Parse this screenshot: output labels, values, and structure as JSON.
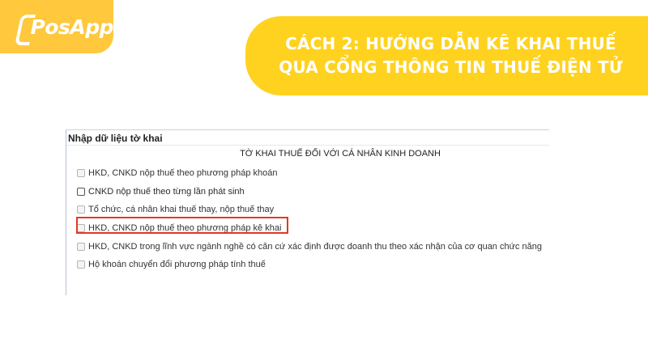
{
  "brand": {
    "logo_text": "PosApp",
    "color": "#FFC83D"
  },
  "banner": {
    "line1": "CÁCH 2: HƯỚNG DẪN KÊ KHAI THUẾ",
    "line2": "QUA CỔNG THÔNG TIN THUẾ ĐIỆN TỬ",
    "color": "#FFD21F"
  },
  "form": {
    "section_title": "Nhập dữ liệu tờ khai",
    "heading": "TỜ KHAI THUẾ ĐỐI VỚI CÁ NHÂN KINH DOANH",
    "options": [
      {
        "label": "HKD, CNKD nộp thuế theo phương pháp khoán",
        "checked": false,
        "enabled": false
      },
      {
        "label": "CNKD nộp thuế theo từng lần phát sinh",
        "checked": false,
        "enabled": true
      },
      {
        "label": "Tổ chức, cá nhân khai thuế thay, nộp thuế thay",
        "checked": false,
        "enabled": false
      },
      {
        "label": "HKD, CNKD nộp thuế theo phương pháp kê khai",
        "checked": false,
        "enabled": false,
        "highlighted": true
      },
      {
        "label": "HKD, CNKD trong lĩnh vực ngành nghề có căn cứ xác định được doanh thu theo xác nhận của cơ quan chức năng",
        "checked": false,
        "enabled": false
      },
      {
        "label": "Hộ khoán chuyển đổi phương pháp tính thuế",
        "checked": false,
        "enabled": false
      }
    ],
    "highlight_color": "#E23A20"
  }
}
